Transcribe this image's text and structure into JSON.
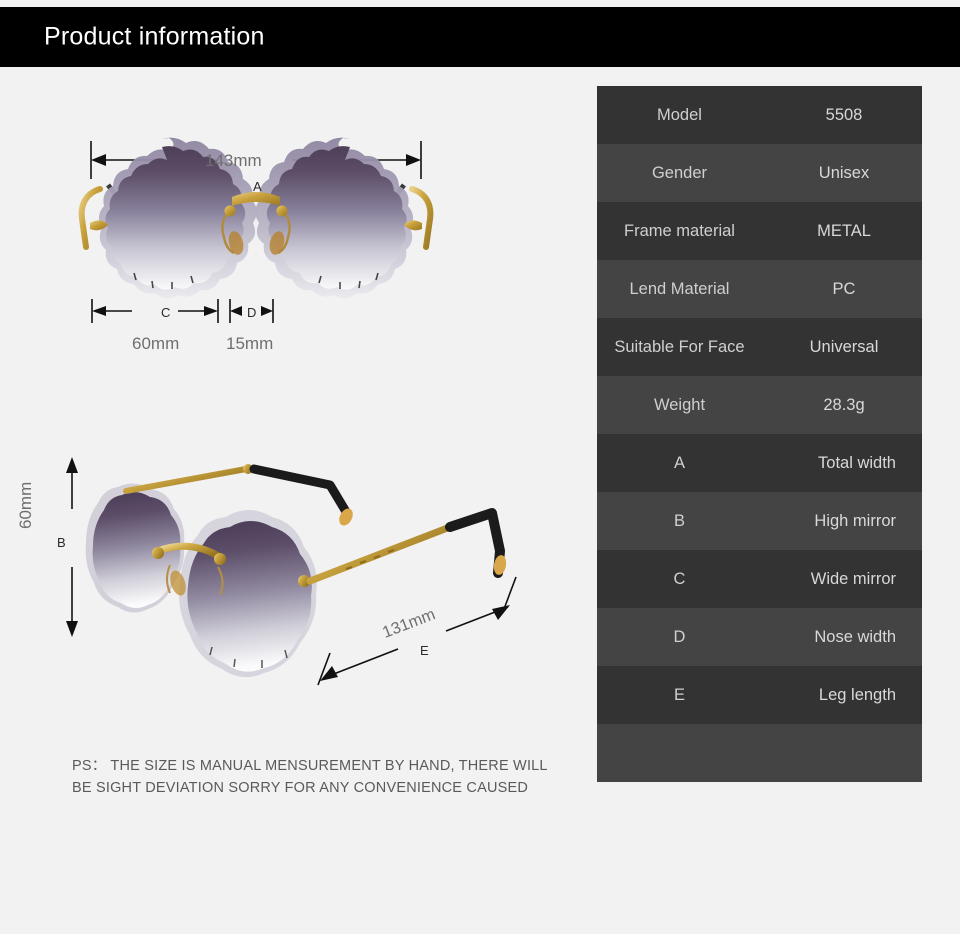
{
  "header": {
    "title": "Product information"
  },
  "diagram": {
    "front_view": {
      "width_label": "143mm",
      "width_letter": "A",
      "lens_width_label": "60mm",
      "lens_width_letter": "C",
      "nose_width_label": "15mm",
      "nose_width_letter": "D"
    },
    "angle_view": {
      "height_label": "60mm",
      "height_letter": "B",
      "temple_label": "131mm",
      "temple_letter": "E"
    }
  },
  "note": {
    "line1": "PS： THE SIZE IS MANUAL MENSUREMENT BY HAND, THERE WILL",
    "line2": "BE SIGHT DEVIATION SORRY FOR ANY CONVENIENCE CAUSED"
  },
  "spec_table": {
    "rows": [
      {
        "key": "Model",
        "value": "5508",
        "style": "pair"
      },
      {
        "key": "Gender",
        "value": "Unisex",
        "style": "pair"
      },
      {
        "key": "Frame material",
        "value": "METAL",
        "style": "pair"
      },
      {
        "key": "Lend Material",
        "value": "PC",
        "style": "pair"
      },
      {
        "key": "Suitable For Face",
        "value": "Universal",
        "style": "pair"
      },
      {
        "key": "Weight",
        "value": "28.3g",
        "style": "pair"
      },
      {
        "key": "A",
        "value": "Total width",
        "style": "letter"
      },
      {
        "key": "B",
        "value": "High mirror",
        "style": "letter"
      },
      {
        "key": "C",
        "value": "Wide mirror",
        "style": "letter"
      },
      {
        "key": "D",
        "value": "Nose width",
        "style": "letter"
      },
      {
        "key": "E",
        "value": "Leg length",
        "style": "letter"
      },
      {
        "key": "",
        "value": "",
        "style": "blank"
      }
    ]
  },
  "colors": {
    "page_background": "#f2f2f2",
    "header_background": "#000000",
    "header_text": "#ffffff",
    "row_dark": "#333333",
    "row_light": "#444444",
    "row_text": "#cfcfcf",
    "dimension_text": "#6f6f6f",
    "note_text": "#5a5a5a",
    "lens_top": "#5a4a62",
    "lens_bottom": "#fbfbfc",
    "metal_gold": "#c9a23c",
    "temple_black": "#1b1b1b"
  }
}
